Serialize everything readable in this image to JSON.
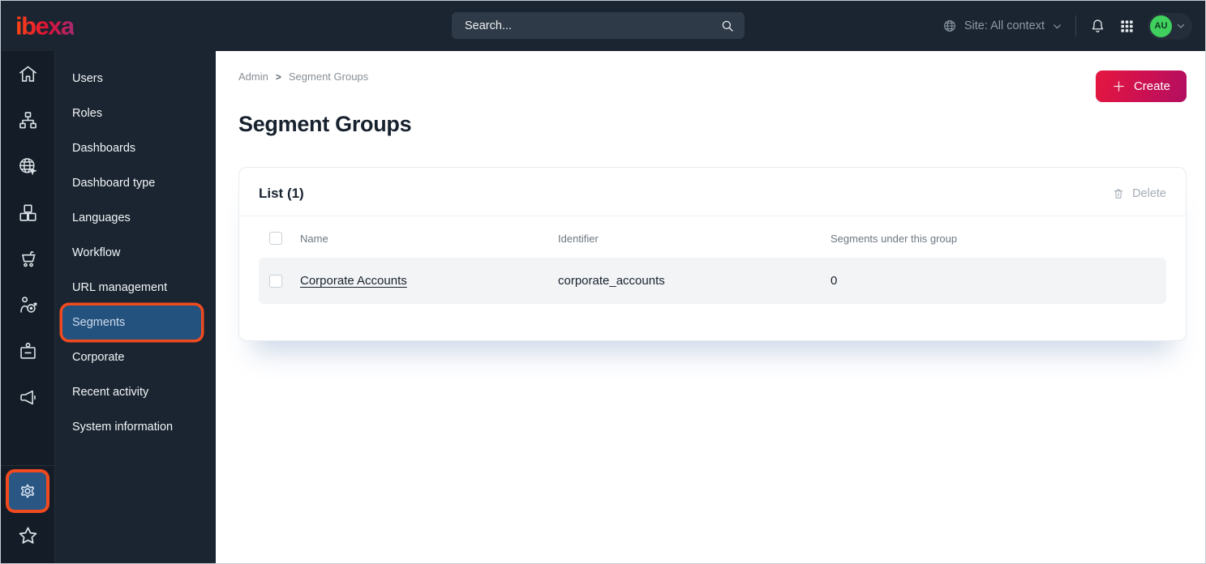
{
  "topbar": {
    "logo_text": "ibexa",
    "search": {
      "placeholder": "Search..."
    },
    "site_context_label": "Site: All context",
    "avatar_initials": "AU"
  },
  "sidebar": {
    "rail_icons": [
      "home",
      "content-tree",
      "site",
      "product-catalog",
      "commerce-cart",
      "personalization-target",
      "customer-badge",
      "campaign-megaphone",
      "settings-gear",
      "bookmarks-star"
    ],
    "menu_items": [
      {
        "label": "Users",
        "selected": false
      },
      {
        "label": "Roles",
        "selected": false
      },
      {
        "label": "Dashboards",
        "selected": false
      },
      {
        "label": "Dashboard type",
        "selected": false
      },
      {
        "label": "Languages",
        "selected": false
      },
      {
        "label": "Workflow",
        "selected": false
      },
      {
        "label": "URL management",
        "selected": false
      },
      {
        "label": "Segments",
        "selected": true
      },
      {
        "label": "Corporate",
        "selected": false
      },
      {
        "label": "Recent activity",
        "selected": false
      },
      {
        "label": "System information",
        "selected": false
      }
    ]
  },
  "breadcrumb": {
    "items": [
      "Admin",
      "Segment Groups"
    ],
    "separator": ">"
  },
  "page": {
    "title": "Segment Groups"
  },
  "actions": {
    "create_label": "Create",
    "delete_label": "Delete"
  },
  "list_card": {
    "title": "List (1)",
    "columns": [
      "Name",
      "Identifier",
      "Segments under this group"
    ],
    "rows": [
      {
        "name": "Corporate Accounts",
        "identifier": "corporate_accounts",
        "segments_under_group": "0"
      }
    ]
  },
  "colors": {
    "topbar_bg": "#1a2531",
    "rail_bg": "#141d27",
    "selected_blue": "#24527f",
    "highlight_orange": "#f04a1e",
    "brand_gradient": [
      "#ff4713",
      "#e01039",
      "#a62a6e"
    ],
    "create_gradient": [
      "#e5173f",
      "#b30f61"
    ],
    "avatar_green": "#3fd05e",
    "row_bg": "#f3f4f6"
  }
}
